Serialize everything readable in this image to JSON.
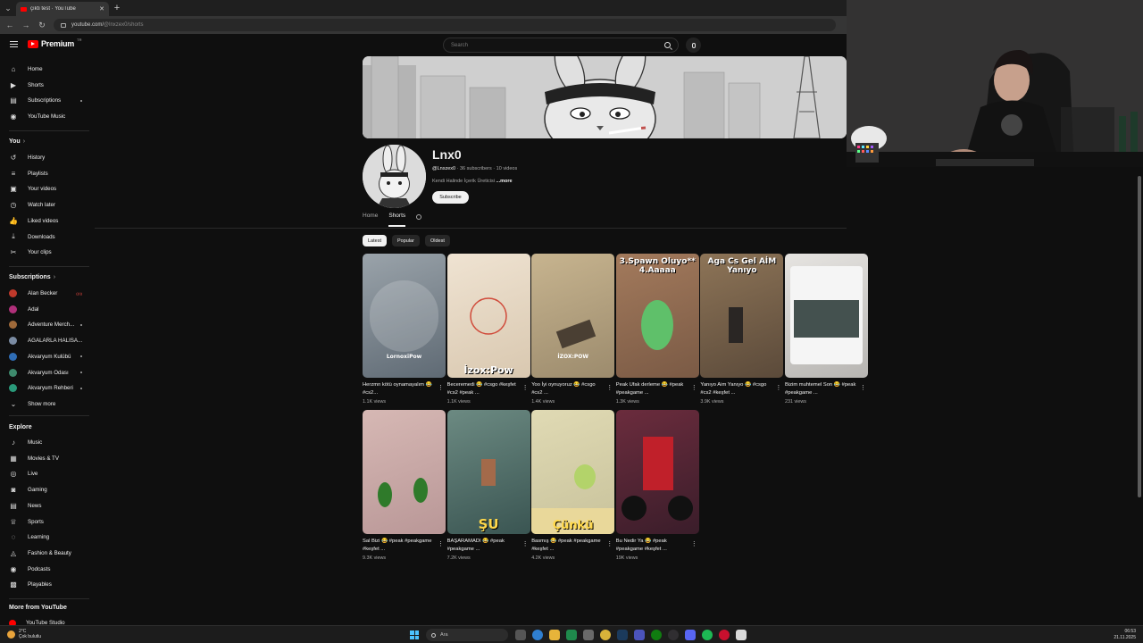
{
  "browser": {
    "tab_title": "çıkti test · YouTube",
    "url_host": "youtube.com/",
    "url_path": "@lnxzex0/shorts"
  },
  "masthead": {
    "logo_text": "Premium",
    "logo_region": "TR",
    "search_placeholder": "Search"
  },
  "sidebar": {
    "main": [
      {
        "label": "Home",
        "icon": "home-icon"
      },
      {
        "label": "Shorts",
        "icon": "shorts-icon"
      },
      {
        "label": "Subscriptions",
        "icon": "subscriptions-icon"
      },
      {
        "label": "YouTube Music",
        "icon": "music-icon"
      }
    ],
    "you_heading": "You",
    "you": [
      {
        "label": "History",
        "icon": "history-icon"
      },
      {
        "label": "Playlists",
        "icon": "playlists-icon"
      },
      {
        "label": "Your videos",
        "icon": "your-videos-icon"
      },
      {
        "label": "Watch later",
        "icon": "clock-icon"
      },
      {
        "label": "Liked videos",
        "icon": "thumbs-up-icon"
      },
      {
        "label": "Downloads",
        "icon": "download-icon"
      },
      {
        "label": "Your clips",
        "icon": "scissors-icon"
      }
    ],
    "subs_heading": "Subscriptions",
    "subs": [
      {
        "label": "Alan Becker",
        "color": "#c0392b",
        "badge": "live"
      },
      {
        "label": "Adal",
        "color": "#b0307a",
        "badge": ""
      },
      {
        "label": "Adventure Merch...",
        "color": "#a06a3a",
        "badge": "dot"
      },
      {
        "label": "AGALARLA HALISA...",
        "color": "#7b8ca3",
        "badge": ""
      },
      {
        "label": "Akvaryum Kulübü",
        "color": "#2f6db5",
        "badge": "dot"
      },
      {
        "label": "Akvaryum Odası",
        "color": "#3e8a6d",
        "badge": "dot"
      },
      {
        "label": "Akvaryum Rehberi",
        "color": "#2a9a7a",
        "badge": "dot"
      }
    ],
    "show_more": "Show more",
    "explore_heading": "Explore",
    "explore": [
      {
        "label": "Music",
        "icon": "music-note-icon"
      },
      {
        "label": "Movies & TV",
        "icon": "film-icon"
      },
      {
        "label": "Live",
        "icon": "live-icon"
      },
      {
        "label": "Gaming",
        "icon": "gamepad-icon"
      },
      {
        "label": "News",
        "icon": "news-icon"
      },
      {
        "label": "Sports",
        "icon": "trophy-icon"
      },
      {
        "label": "Learning",
        "icon": "bulb-icon"
      },
      {
        "label": "Fashion & Beauty",
        "icon": "hanger-icon"
      },
      {
        "label": "Podcasts",
        "icon": "podcast-icon"
      },
      {
        "label": "Playables",
        "icon": "playables-icon"
      }
    ],
    "more_heading": "More from YouTube",
    "studio": "YouTube Studio"
  },
  "channel": {
    "name": "Lnx0",
    "handle": "@Lnxzex0",
    "subscribers": "36 subscribers",
    "videos": "10 videos",
    "description": "Kendi Halinde İçerik Üreticisi",
    "more": "...more",
    "subscribe": "Subscribe",
    "tabs": [
      "Home",
      "Shorts"
    ],
    "active_tab": "Shorts"
  },
  "chips": [
    "Latest",
    "Popular",
    "Oldest"
  ],
  "shorts": [
    {
      "title": "Herzmn kötü oynamayalım 😂 #cs2...",
      "views": "1.1K views",
      "caption": "LornoxiPow",
      "bg1": "#5f6a74",
      "bg2": "#9aa3aa"
    },
    {
      "title": "Beceremedi 😂 #csgo #keşfet #cs2 #peak ...",
      "views": "1.1K views",
      "caption": "İzox:Pow",
      "bg1": "#d9c8b0",
      "bg2": "#efe3d2"
    },
    {
      "title": "Yoo İyi oynuyoruz 😂 #csgo #cs2 ...",
      "views": "1.4K views",
      "caption": "İZOX:POW",
      "bg1": "#9c8b6d",
      "bg2": "#c7b48f"
    },
    {
      "title": "Peak Ufak derleme 😂 #peak #peakgame ...",
      "views": "1.3K views",
      "caption": "3.Spawn Oluyo** 4.Aaaaa",
      "bg1": "#7a5a45",
      "bg2": "#a37a5c"
    },
    {
      "title": "Yanıyo Aim Yanıyo 😂 #csgo #cs2 #keşfet ...",
      "views": "3.9K views",
      "caption": "Aga Cs Gel AİM Yanıyo",
      "bg1": "#5b4a3a",
      "bg2": "#8d7457"
    },
    {
      "title": "Bizim muhtemel Son 😂 #peak #peakgame ...",
      "views": "231 views",
      "caption": "",
      "bg1": "#b7b5b2",
      "bg2": "#e6e4e1"
    },
    {
      "title": "Sal Bizi 😂 #peak #peakgame #keşfet ...",
      "views": "9.3K views",
      "caption": "",
      "bg1": "#b99797",
      "bg2": "#d6b8b4"
    },
    {
      "title": "BAŞARAMADI 😂 #peak #peakgame ...",
      "views": "7.2K views",
      "caption": "ŞU",
      "bg1": "#3a5552",
      "bg2": "#6c8a82"
    },
    {
      "title": "Basmış 😂 #peak #peakgame #keşfet ...",
      "views": "4.2K views",
      "caption": "Çünkü",
      "bg1": "#c8c29b",
      "bg2": "#e0dab4"
    },
    {
      "title": "Bu Nedir Ya 😂 #peak #peakgame #keşfet ...",
      "views": "19K views",
      "caption": "",
      "bg1": "#3a1d2a",
      "bg2": "#6b2c3d"
    }
  ],
  "taskbar": {
    "weather_temp": "2°C",
    "weather_desc": "Çok bulutlu",
    "search": "Ara",
    "time": "06:53",
    "date": "21.11.2025"
  }
}
